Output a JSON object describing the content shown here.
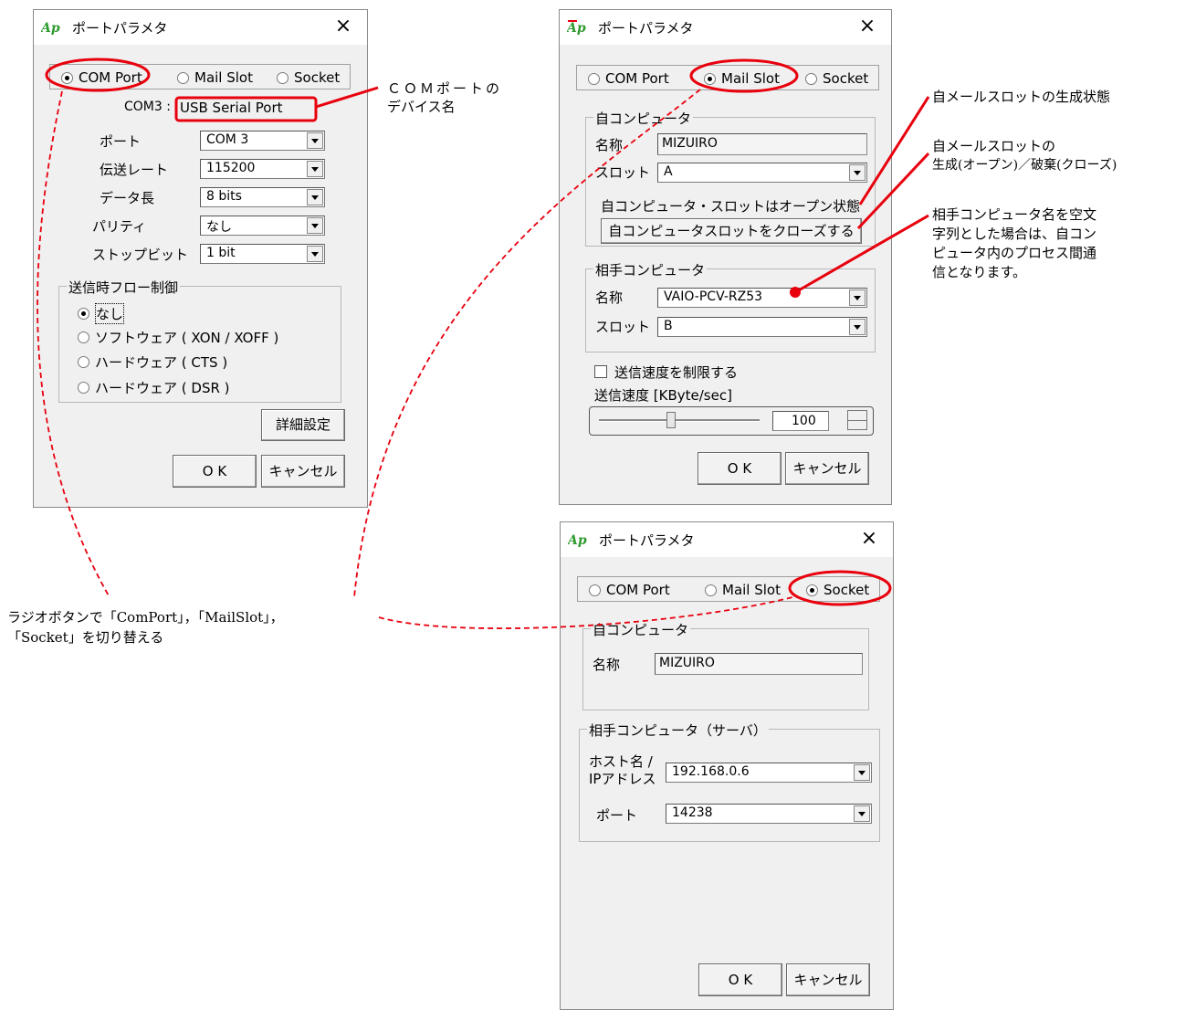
{
  "colors": {
    "accent_red": "#e8000d",
    "dialog_bg": "#f0f0f0",
    "logo_green": "#2e9a2e"
  },
  "dialogs": {
    "com": {
      "title": "ポートパラメタ",
      "close_glyph": "×",
      "radios": [
        "COM Port",
        "Mail Slot",
        "Socket"
      ],
      "selected_radio": "COM Port",
      "device_prefix": "COM3 :",
      "device_name": "USB Serial Port",
      "fields": [
        {
          "label": "ポート",
          "value": "COM 3"
        },
        {
          "label": "伝送レート",
          "value": "115200"
        },
        {
          "label": "データ長",
          "value": "8 bits"
        },
        {
          "label": "パリティ",
          "value": "なし"
        },
        {
          "label": "ストップビット",
          "value": "1 bit"
        }
      ],
      "flow_group": "送信時フロー制御",
      "flow_options": [
        "なし",
        "ソフトウェア ( XON / XOFF )",
        "ハードウェア ( CTS )",
        "ハードウェア ( DSR )"
      ],
      "flow_selected": "なし",
      "detail_button": "詳細設定",
      "ok": "O K",
      "cancel": "キャンセル"
    },
    "mailslot": {
      "title": "ポートパラメタ",
      "close_glyph": "×",
      "radios": [
        "COM Port",
        "Mail Slot",
        "Socket"
      ],
      "selected_radio": "Mail Slot",
      "own_group": "自コンピュータ",
      "own_name_label": "名称",
      "own_name": "MIZUIRO",
      "own_slot_label": "スロット",
      "own_slot": "A",
      "status_text": "自コンピュータ・スロットはオープン状態",
      "close_slot_button": "自コンピュータスロットをクローズする",
      "remote_group": "相手コンピュータ",
      "remote_name_label": "名称",
      "remote_name": "VAIO-PCV-RZ53",
      "remote_slot_label": "スロット",
      "remote_slot": "B",
      "limit_checkbox": "送信速度を制限する",
      "limit_checked": false,
      "speed_label": "送信速度 [KByte/sec]",
      "speed_value": "100",
      "ok": "O K",
      "cancel": "キャンセル"
    },
    "socket": {
      "title": "ポートパラメタ",
      "close_glyph": "×",
      "radios": [
        "COM Port",
        "Mail Slot",
        "Socket"
      ],
      "selected_radio": "Socket",
      "own_group": "自コンピュータ",
      "own_name_label": "名称",
      "own_name": "MIZUIRO",
      "server_group": "相手コンピュータ（サーバ）",
      "host_label_1": "ホスト名 /",
      "host_label_2": "IPアドレス",
      "host_value": "192.168.0.6",
      "port_label": "ポート",
      "port_value": "14238",
      "ok": "O K",
      "cancel": "キャンセル"
    }
  },
  "annotations": {
    "com_device_1": "ＣＯＭポートの",
    "com_device_2": "デバイス名",
    "slot_status": "自メールスロットの生成状態",
    "slot_toggle_1": "自メールスロットの",
    "slot_toggle_2": "生成(オープン)／破棄(クローズ)",
    "remote_note_1": "相手コンピュータ名を空文",
    "remote_note_2": "字列とした場合は、自コン",
    "remote_note_3": "ピュータ内のプロセス間通",
    "remote_note_4": "信となります。",
    "radio_switch_1": "ラジオボタンで「ComPort」，「MailSlot」，",
    "radio_switch_2": "「Socket」を切り替える"
  }
}
